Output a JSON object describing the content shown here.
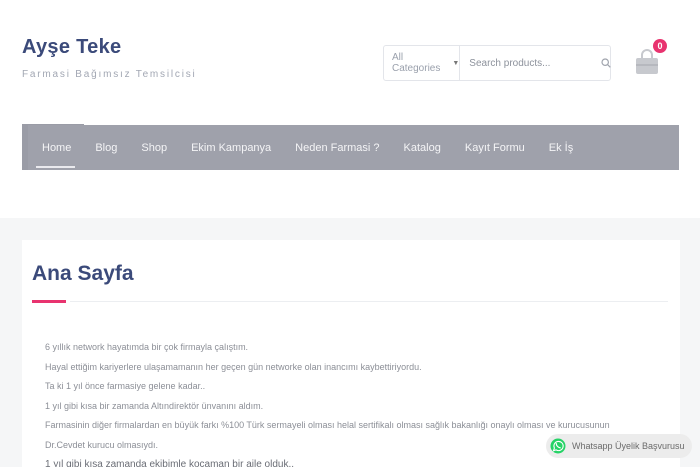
{
  "site": {
    "title": "Ayşe Teke",
    "tagline": "Farmasi Bağımsız Temsilcisi"
  },
  "search": {
    "category": "All Categories",
    "placeholder": "Search products..."
  },
  "cart": {
    "count": "0"
  },
  "nav": {
    "items": [
      {
        "label": "Home",
        "active": true
      },
      {
        "label": "Blog"
      },
      {
        "label": "Shop"
      },
      {
        "label": "Ekim Kampanya"
      },
      {
        "label": "Neden Farmasi ?"
      },
      {
        "label": "Katalog"
      },
      {
        "label": "Kayıt Formu"
      },
      {
        "label": "Ek İş"
      }
    ]
  },
  "page": {
    "title": "Ana Sayfa",
    "lines": [
      "6 yıllık network hayatımda bir çok firmayla çalıştım.",
      "Hayal ettiğim kariyerlere ulaşamamanın her geçen gün networke olan inancımı kaybettiriyordu.",
      "Ta ki 1 yıl önce farmasiye gelene kadar..",
      "1 yıl gibi kısa bir zamanda Altındirektör ünvanını aldım.",
      "Farmasinin diğer firmalardan en büyük farkı %100 Türk sermayeli olması helal sertifikalı olması sağlık bakanlığı onaylı olması ve kurucusunun",
      "Dr.Cevdet kurucu olmasıydı.",
      "1 yıl gibi kısa zamanda ekibimle kocaman bir aile olduk.."
    ]
  },
  "whatsapp": {
    "label": "Whatsapp Üyelik Başvurusu"
  },
  "colors": {
    "brand": "#3b4a7a",
    "accent": "#e8336f",
    "nav_bg": "#9fa1ab",
    "whatsapp": "#25d366"
  }
}
